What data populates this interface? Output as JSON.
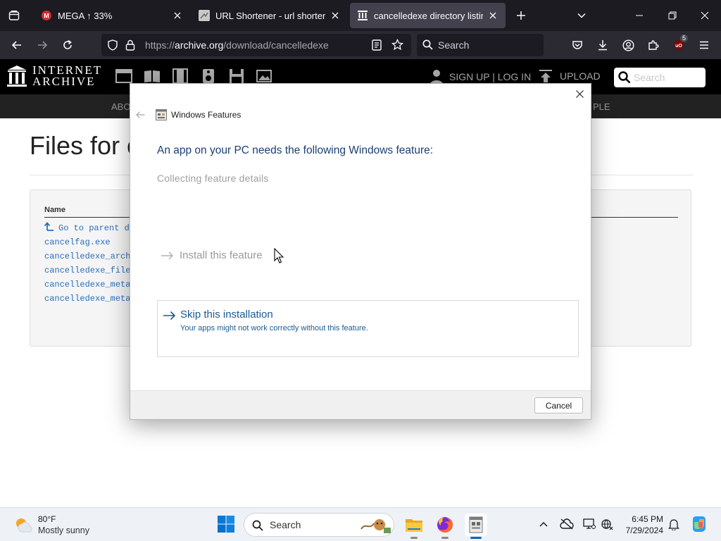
{
  "browser": {
    "tabs": [
      {
        "title": "MEGA ↑ 33%",
        "icon": "mega-icon"
      },
      {
        "title": "URL Shortener - url shortening",
        "icon": "url-shortener-icon"
      },
      {
        "title": "cancelledexe directory listing",
        "icon": "archive-columns-icon",
        "active": true
      }
    ],
    "url_prefix": "https://",
    "url_host": "archive.org",
    "url_path": "/download/cancelledexe",
    "search_placeholder": "Search",
    "extension_badge": "5"
  },
  "ia": {
    "logo_line1": "INTERNET",
    "logo_line2": "ARCHIVE",
    "signup": "SIGN UP | LOG IN",
    "upload": "UPLOAD",
    "search_placeholder": "Search",
    "nav_left": "ABO",
    "nav_right": "PLE"
  },
  "page": {
    "title": "Files for c",
    "column_name": "Name",
    "files": [
      "Go to parent d",
      "cancelfag.exe",
      "cancelledexe_arch",
      "cancelledexe_file",
      "cancelledexe_meta",
      "cancelledexe_meta"
    ]
  },
  "dialog": {
    "window_title": "Windows Features",
    "heading": "An app on your PC needs the following Windows feature:",
    "status": "Collecting feature details",
    "install_option": "Install this feature",
    "skip_title": "Skip this installation",
    "skip_desc": "Your apps might not work correctly without this feature.",
    "cancel": "Cancel"
  },
  "taskbar": {
    "weather_temp": "80°F",
    "weather_desc": "Mostly sunny",
    "search_placeholder": "Search",
    "time": "6:45 PM",
    "date": "7/29/2024"
  }
}
